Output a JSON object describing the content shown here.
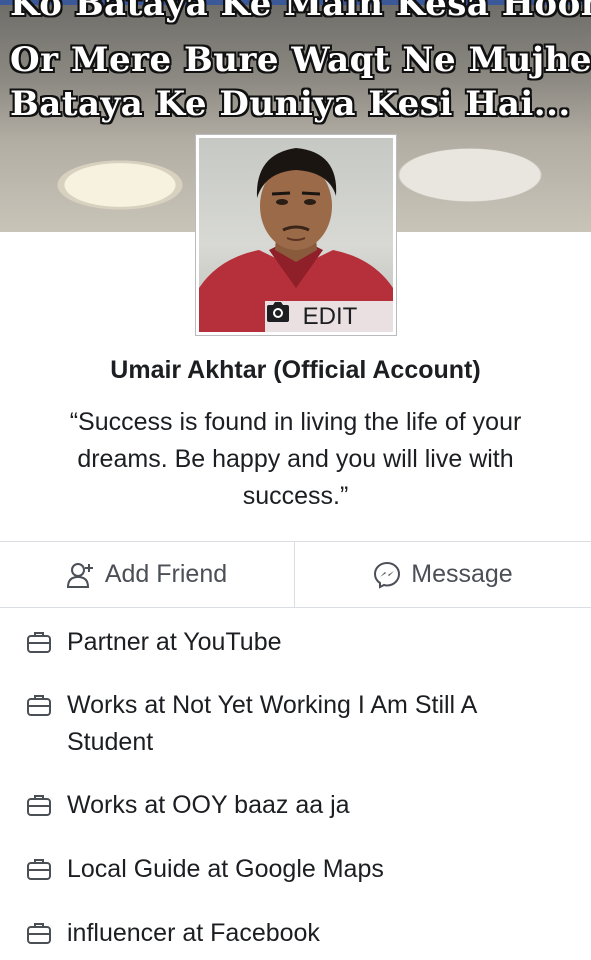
{
  "cover": {
    "lines": [
      "Ko Bataya Ke Main Kesa Hoon,",
      "Or Mere Bure Waqt Ne Mujhe",
      "Bataya Ke Duniya Kesi Hai..."
    ]
  },
  "profile": {
    "edit_label": "EDIT",
    "name": "Umair Akhtar (Official Account)",
    "bio": "“Success is found in living the life of your dreams. Be happy and you will live with success.”"
  },
  "actions": {
    "add_friend_label": "Add Friend",
    "message_label": "Message"
  },
  "info": [
    {
      "icon": "briefcase-icon",
      "text": "Partner at YouTube"
    },
    {
      "icon": "briefcase-icon",
      "text": "Works at Not Yet Working I Am Still A Student"
    },
    {
      "icon": "briefcase-icon",
      "text": "Works at OOY baaz aa ja"
    },
    {
      "icon": "briefcase-icon",
      "text": "Local Guide at Google Maps"
    },
    {
      "icon": "briefcase-icon",
      "text": "influencer at Facebook"
    }
  ],
  "colors": {
    "brand": "#3b5998",
    "text": "#1c1e21",
    "secondary_text": "#4b4f56",
    "divider": "#dadde1"
  }
}
